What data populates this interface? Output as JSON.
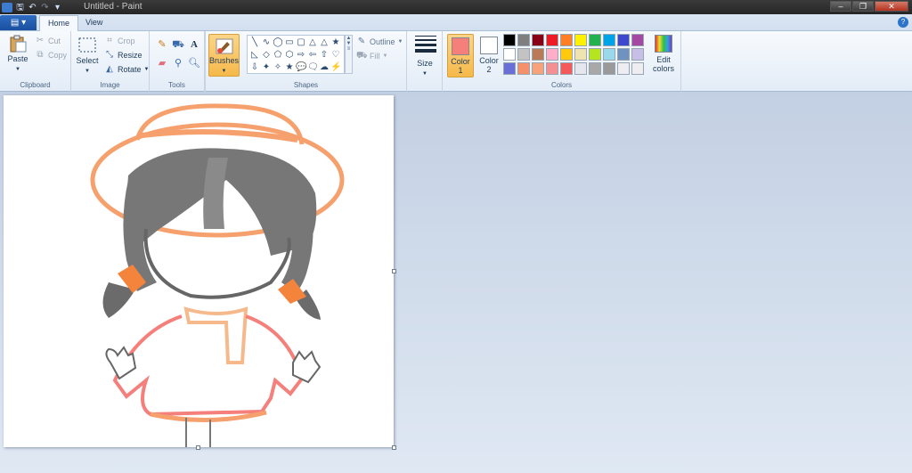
{
  "window": {
    "title": "Untitled - Paint",
    "controls": [
      "–",
      "❐",
      "✕"
    ]
  },
  "qat": [
    "🖫",
    "↶",
    "↷",
    "▾"
  ],
  "tabs": {
    "app_menu": "▤ ▾",
    "items": [
      {
        "label": "Home",
        "active": true
      },
      {
        "label": "View",
        "active": false
      }
    ],
    "help": "?"
  },
  "ribbon": {
    "clipboard": {
      "label": "Clipboard",
      "paste": "Paste",
      "cut": "Cut",
      "copy": "Copy"
    },
    "image": {
      "label": "Image",
      "select": "Select",
      "crop": "Crop",
      "resize": "Resize",
      "rotate": "Rotate"
    },
    "tools": {
      "label": "Tools",
      "icons": [
        "pencil-icon",
        "fill-icon",
        "text-icon",
        "eraser-icon",
        "color-picker-icon",
        "magnifier-icon"
      ]
    },
    "brushes": {
      "label": "Brushes"
    },
    "shapes": {
      "label": "Shapes",
      "outline": "Outline",
      "fill": "Fill",
      "glyphs": [
        "╲",
        "∿",
        "◯",
        "▭",
        "▢",
        "△",
        "◺",
        "◇",
        "⬠",
        "⬡",
        "⇨",
        "⇦",
        "⇧",
        "⇩",
        "✦",
        "✧",
        "★",
        "✶",
        "💬",
        "🗨",
        "☁",
        "♡",
        "⚡",
        "▱"
      ]
    },
    "size": {
      "label": "Size"
    },
    "colors": {
      "label": "Colors",
      "color1": {
        "label_line1": "Color",
        "label_line2": "1",
        "value": "#f47f7b"
      },
      "color2": {
        "label_line1": "Color",
        "label_line2": "2",
        "value": "#ffffff"
      },
      "edit": {
        "label_line1": "Edit",
        "label_line2": "colors"
      },
      "palette": [
        [
          "#000000",
          "#7f7f7f",
          "#880015",
          "#ed1c24",
          "#ff7f27",
          "#fff200",
          "#22b14c",
          "#00a2e8",
          "#3f48cc",
          "#a349a4"
        ],
        [
          "#ffffff",
          "#c3c3c3",
          "#b97a57",
          "#ffaec9",
          "#ffc90e",
          "#efe4b0",
          "#b5e61d",
          "#99d9ea",
          "#7092be",
          "#c8bfe7"
        ],
        [
          "#6a6fd8",
          "#f4916a",
          "#f6a27a",
          "#f48f93",
          "#f45a5a",
          "#e6e6ee",
          "#a8a8a8",
          "#9a9a9a",
          "#eeeef2",
          "#eeeef2"
        ]
      ]
    }
  },
  "canvas": {
    "drawing": "chibi girl with orange hat, gray pigtails with orange bows, pink sweater"
  }
}
